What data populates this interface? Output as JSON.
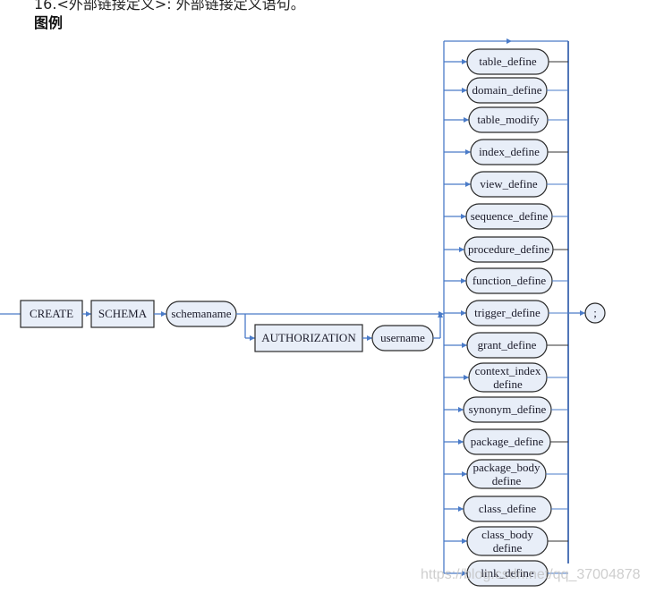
{
  "header_partial": "16.<外部链接定义>: 外部链接定义语句。",
  "heading": "图例",
  "diagram": {
    "main": [
      {
        "label": "CREATE",
        "kind": "keyword"
      },
      {
        "label": "SCHEMA",
        "kind": "keyword"
      },
      {
        "label": "schemaname",
        "kind": "nonterminal"
      }
    ],
    "optional": [
      {
        "label": "AUTHORIZATION",
        "kind": "keyword"
      },
      {
        "label": "username",
        "kind": "nonterminal"
      }
    ],
    "choices": [
      [
        "table_define"
      ],
      [
        "domain_define"
      ],
      [
        "table_modify"
      ],
      [
        "index_define"
      ],
      [
        "view_define"
      ],
      [
        "sequence_define"
      ],
      [
        "procedure_define"
      ],
      [
        "function_define"
      ],
      [
        "trigger_define"
      ],
      [
        "grant_define"
      ],
      [
        "context_index",
        "define"
      ],
      [
        "synonym_define"
      ],
      [
        "package_define"
      ],
      [
        "package_body",
        "define"
      ],
      [
        "class_define"
      ],
      [
        "class_body",
        "define"
      ],
      [
        "link_define"
      ]
    ],
    "terminator": ";"
  },
  "colors": {
    "line": "#4a7bc8",
    "fill": "#e8eef8",
    "stroke": "#2a2a2a"
  },
  "watermark": "https://blog.csdn.net/qq_37004878"
}
